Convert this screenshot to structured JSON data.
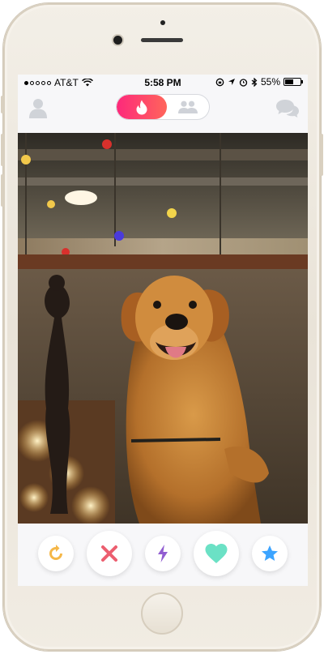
{
  "status_bar": {
    "carrier": "AT&T",
    "time": "5:58 PM",
    "battery": "55%",
    "battery_level": 0.55,
    "signal_dots_filled": 1,
    "signal_dots_total": 5
  },
  "nav": {
    "profile_icon": "person-icon",
    "mode_active_icon": "flame-icon",
    "mode_inactive_icon": "group-icon",
    "messages_icon": "chat-bubbles-icon",
    "active_gradient": [
      "#fd297b",
      "#ff655b"
    ]
  },
  "card": {
    "subject": "golden retriever photo"
  },
  "actions": [
    {
      "name": "rewind",
      "icon": "rewind-icon",
      "color": "#f5b748"
    },
    {
      "name": "nope",
      "icon": "x-icon",
      "color": "#ec5e6f"
    },
    {
      "name": "boost",
      "icon": "lightning-icon",
      "color": "#915dd1"
    },
    {
      "name": "like",
      "icon": "heart-icon",
      "color": "#6be1c5"
    },
    {
      "name": "super-like",
      "icon": "star-icon",
      "color": "#3ca4ff"
    }
  ]
}
